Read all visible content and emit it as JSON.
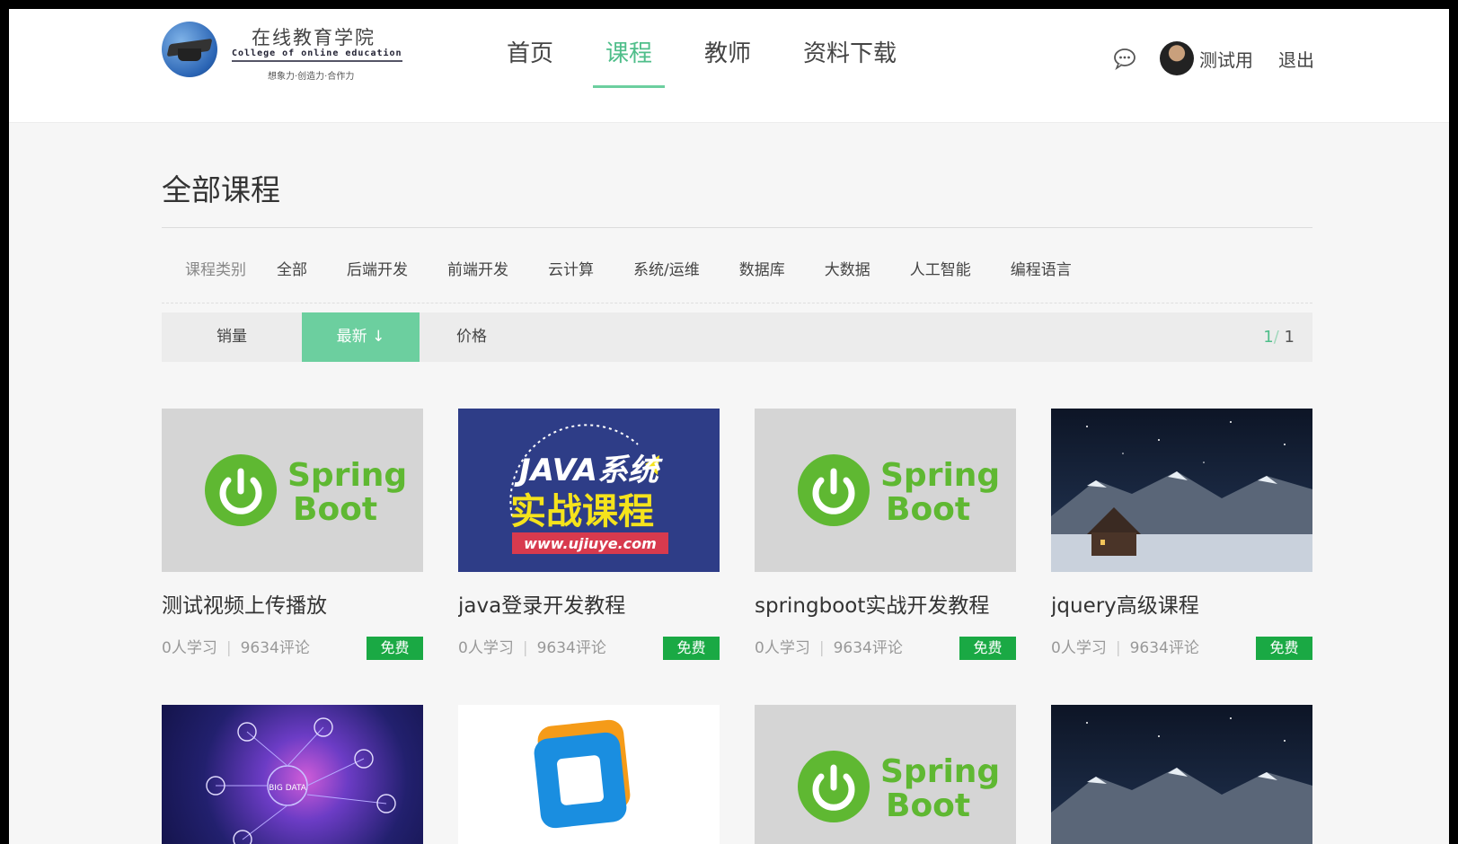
{
  "header": {
    "logo": {
      "cn": "在线教育学院",
      "en": "College of online education",
      "slogan": "想象力·创造力·合作力"
    },
    "nav": [
      {
        "label": "首页",
        "active": false
      },
      {
        "label": "课程",
        "active": true
      },
      {
        "label": "教师",
        "active": false
      },
      {
        "label": "资料下载",
        "active": false
      }
    ],
    "user": {
      "name": "测试用",
      "logout": "退出",
      "message_icon": "chat-bubble-icon"
    }
  },
  "main": {
    "title": "全部课程",
    "categories": {
      "label": "课程类别",
      "items": [
        "全部",
        "后端开发",
        "前端开发",
        "云计算",
        "系统/运维",
        "数据库",
        "大数据",
        "人工智能",
        "编程语言"
      ]
    },
    "sort": {
      "items": [
        "销量",
        "最新 ↓",
        "价格"
      ],
      "active_index": 1
    },
    "pager": {
      "current": "1",
      "separator": "/",
      "total": " 1"
    },
    "courses": [
      {
        "title": "测试视频上传播放",
        "learners": "0人学习",
        "comments": "9634评论",
        "price": "免费",
        "thumb": "spring"
      },
      {
        "title": "java登录开发教程",
        "learners": "0人学习",
        "comments": "9634评论",
        "price": "免费",
        "thumb": "java"
      },
      {
        "title": "springboot实战开发教程",
        "learners": "0人学习",
        "comments": "9634评论",
        "price": "免费",
        "thumb": "spring"
      },
      {
        "title": "jquery高级课程",
        "learners": "0人学习",
        "comments": "9634评论",
        "price": "免费",
        "thumb": "night"
      },
      {
        "title": "",
        "learners": "",
        "comments": "",
        "price": "",
        "thumb": "bigdata"
      },
      {
        "title": "",
        "learners": "",
        "comments": "",
        "price": "",
        "thumb": "vmware"
      },
      {
        "title": "",
        "learners": "",
        "comments": "",
        "price": "",
        "thumb": "spring"
      },
      {
        "title": "",
        "learners": "",
        "comments": "",
        "price": "",
        "thumb": "night"
      }
    ],
    "thumb_text": {
      "spring_line1": "Spring",
      "spring_line2": "Boot",
      "java_line1": "JAVA系统",
      "java_line2": "实战课程",
      "java_url": "www.ujiuye.com",
      "bigdata": "BIG DATA"
    }
  },
  "colors": {
    "accent": "#6ccf9f",
    "accent_text": "#4fbe8a",
    "free_badge": "#1aa944",
    "spring_green": "#5fb832"
  }
}
